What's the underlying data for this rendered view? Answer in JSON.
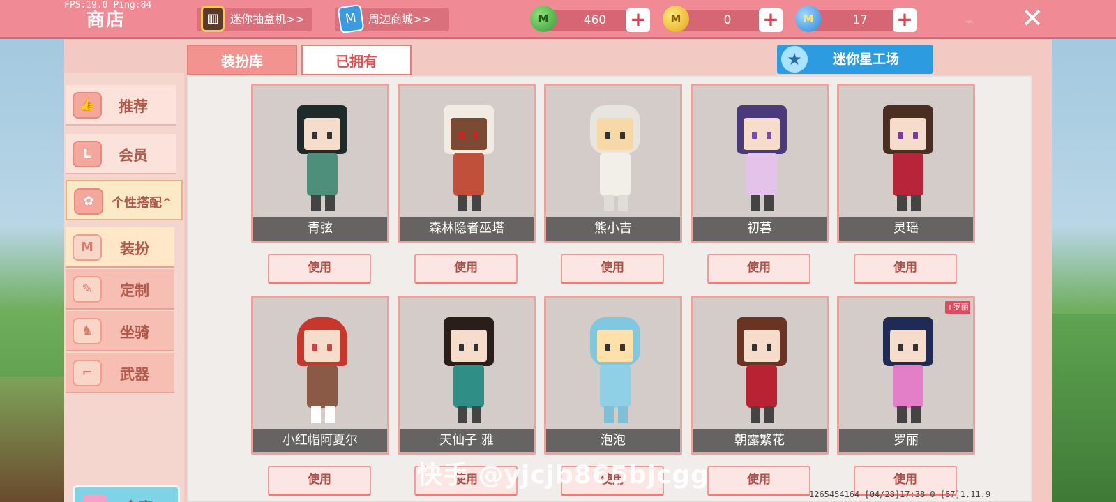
{
  "status": {
    "fps": "FPS:19.0  Ping:84"
  },
  "header": {
    "title": "商店",
    "gacha_link": "迷你抽盒机>>",
    "mall_link": "周边商城>>",
    "currencies": [
      {
        "icon": "green-gem-icon",
        "value": "460"
      },
      {
        "icon": "gold-coin-icon",
        "value": "0"
      },
      {
        "icon": "blue-m-coin-icon",
        "value": "17"
      }
    ]
  },
  "sidebar": {
    "items": [
      {
        "label": "推荐",
        "icon": "thumbs-up-icon"
      },
      {
        "label": "会员",
        "icon": "member-card-icon"
      },
      {
        "label": "个性搭配^",
        "icon": "flower-badge-icon"
      },
      {
        "label": "装扮",
        "icon": "shirt-icon"
      },
      {
        "label": "定制",
        "icon": "pencil-icon"
      },
      {
        "label": "坐骑",
        "icon": "mount-icon"
      },
      {
        "label": "武器",
        "icon": "gun-icon"
      }
    ],
    "warehouse": "仓库"
  },
  "tabs": [
    "装扮库",
    "已拥有"
  ],
  "workshop": "迷你星工场",
  "costumes": [
    {
      "name": "青弦",
      "action": "使用"
    },
    {
      "name": "森林隐者巫塔",
      "action": "使用"
    },
    {
      "name": "熊小吉",
      "action": "使用"
    },
    {
      "name": "初暮",
      "action": "使用"
    },
    {
      "name": "灵瑶",
      "action": "使用"
    },
    {
      "name": "小红帽阿夏尔",
      "action": "使用"
    },
    {
      "name": "天仙子 雅",
      "action": "使用"
    },
    {
      "name": "泡泡",
      "action": "使用"
    },
    {
      "name": "朝露繁花",
      "action": "使用"
    },
    {
      "name": "罗丽",
      "action": "使用",
      "badge": "+罗丽"
    }
  ],
  "footer": {
    "ids": "1265454164    [04/28]17:38 0  [57]1.11.9"
  },
  "watermark": "快手 @yjcjb865bjcgg",
  "colors": {
    "topbar": "#f08a95",
    "accent_red": "#e2404e",
    "workshop_blue": "#2d9be0"
  }
}
